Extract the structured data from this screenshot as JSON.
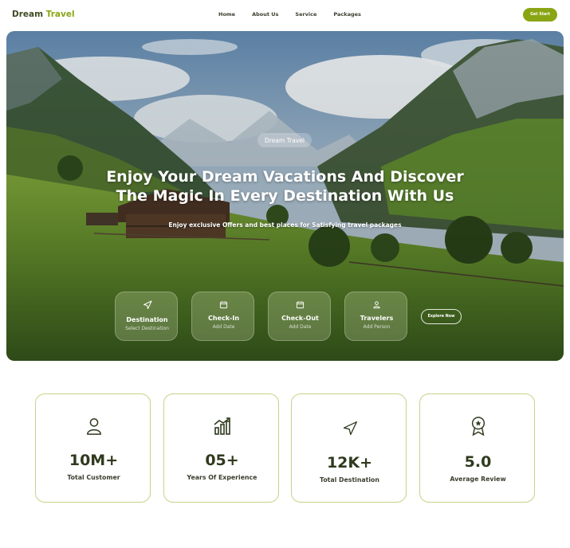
{
  "nav": {
    "brand_first": "Dream",
    "brand_second": "Travel",
    "links": [
      "Home",
      "About Us",
      "Service",
      "Packages"
    ],
    "cta_label": "Get Start"
  },
  "hero": {
    "badge": "Dream Travel",
    "title_line1": "Enjoy Your Dream Vacations And Discover",
    "title_line2": "The Magic In Every Destination With Us",
    "subtitle": "Enjoy exclusive Offers and best places for Satisfying travel packages",
    "search_cards": [
      {
        "icon": "navigation-arrow-icon",
        "title": "Destination",
        "subtitle": "Select Destination"
      },
      {
        "icon": "calendar-icon",
        "title": "Check-In",
        "subtitle": "Add Date"
      },
      {
        "icon": "calendar-icon",
        "title": "Check-Out",
        "subtitle": "Add Date"
      },
      {
        "icon": "user-icon",
        "title": "Travelers",
        "subtitle": "Add Person"
      }
    ],
    "explore_label": "Explore Now"
  },
  "stats": [
    {
      "icon": "user-icon",
      "value": "10M+",
      "label": "Total Customer"
    },
    {
      "icon": "growth-chart-icon",
      "value": "05+",
      "label": "Years Of Experience"
    },
    {
      "icon": "navigation-arrow-icon",
      "value": "12K+",
      "label": "Total Destination"
    },
    {
      "icon": "award-medal-icon",
      "value": "5.0",
      "label": "Average Review"
    }
  ],
  "colors": {
    "accent": "#8aa514",
    "dark_text": "#2f3a1e",
    "card_border": "#c4d388"
  }
}
